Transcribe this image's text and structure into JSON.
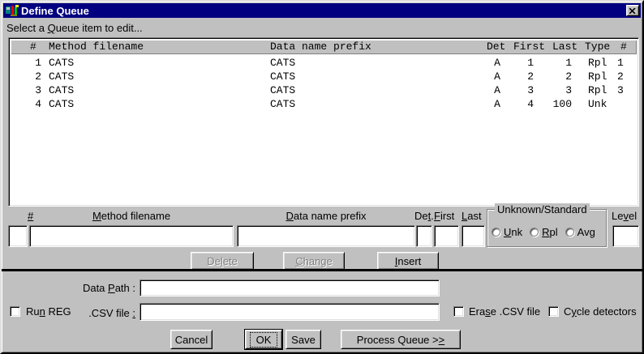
{
  "colors": {
    "titlebar": "#000080",
    "face": "#c0c0c0",
    "title_text": "#ffffff"
  },
  "window": {
    "title": "Define Queue",
    "close_icon": "close-x"
  },
  "prompt": {
    "text": "Select a Queue item to edit...",
    "accel": 9
  },
  "queue": {
    "header": {
      "num": "#",
      "method": "Method filename",
      "prefix": "Data name prefix",
      "det": "Det",
      "first": "First",
      "last": "Last",
      "type": "Type",
      "count": "#"
    },
    "rows": [
      {
        "num": "1",
        "method": "CATS",
        "prefix": "CATS",
        "det": "A",
        "first": "1",
        "last": "1",
        "type": "Rpl",
        "count": "1"
      },
      {
        "num": "2",
        "method": "CATS",
        "prefix": "CATS",
        "det": "A",
        "first": "2",
        "last": "2",
        "type": "Rpl",
        "count": "2"
      },
      {
        "num": "3",
        "method": "CATS",
        "prefix": "CATS",
        "det": "A",
        "first": "3",
        "last": "3",
        "type": "Rpl",
        "count": "3"
      },
      {
        "num": "4",
        "method": "CATS",
        "prefix": "CATS",
        "det": "A",
        "first": "4",
        "last": "100",
        "type": "Unk",
        "count": ""
      }
    ]
  },
  "editor": {
    "labels": {
      "num": {
        "text": "#",
        "accel": 0
      },
      "method": {
        "text": "Method filename",
        "accel": 0
      },
      "prefix": {
        "text": "Data name prefix",
        "accel": 0
      },
      "det": {
        "text": "Det.",
        "accel": 2
      },
      "first": {
        "text": "First",
        "accel": 0
      },
      "last": {
        "text": "Last",
        "accel": 0
      },
      "level": {
        "text": "Level",
        "accel": 2
      }
    },
    "inputs": {
      "num": "",
      "method": "",
      "prefix": "",
      "det": "",
      "first": "",
      "last": "",
      "level": ""
    },
    "group": {
      "legend": "Unknown/Standard",
      "options": {
        "unk": {
          "text": "Unk",
          "accel": 0,
          "selected": false
        },
        "rpl": {
          "text": "Rpl",
          "accel": 0,
          "selected": false
        },
        "avg": {
          "text": "Avg",
          "accel": 2,
          "selected": false
        }
      }
    },
    "buttons": {
      "delete": {
        "text": "Delete",
        "accel": 2,
        "disabled": true
      },
      "change": {
        "text": "Change",
        "accel": 0,
        "disabled": true
      },
      "insert": {
        "text": "Insert",
        "accel": 0,
        "disabled": false
      }
    }
  },
  "footer": {
    "data_path_label": {
      "text": "Data Path :",
      "accel": 5
    },
    "data_path_value": "",
    "run_reg": {
      "text": "Run REG",
      "accel": 2,
      "checked": false
    },
    "csv_label": {
      "text": ".CSV file :",
      "accel": 10
    },
    "csv_value": "",
    "erase_csv": {
      "text": "Erase .CSV file",
      "accel": 3,
      "checked": false
    },
    "cycle_detectors": {
      "text": "Cycle detectors",
      "accel": 1,
      "checked": false
    },
    "buttons": {
      "cancel": {
        "text": "Cancel",
        "accel": -1
      },
      "ok": {
        "text": "OK",
        "accel": -1,
        "default": true
      },
      "save": {
        "text": "Save",
        "accel": -1
      },
      "process": {
        "text": "Process Queue >>",
        "accel": 15
      }
    }
  }
}
